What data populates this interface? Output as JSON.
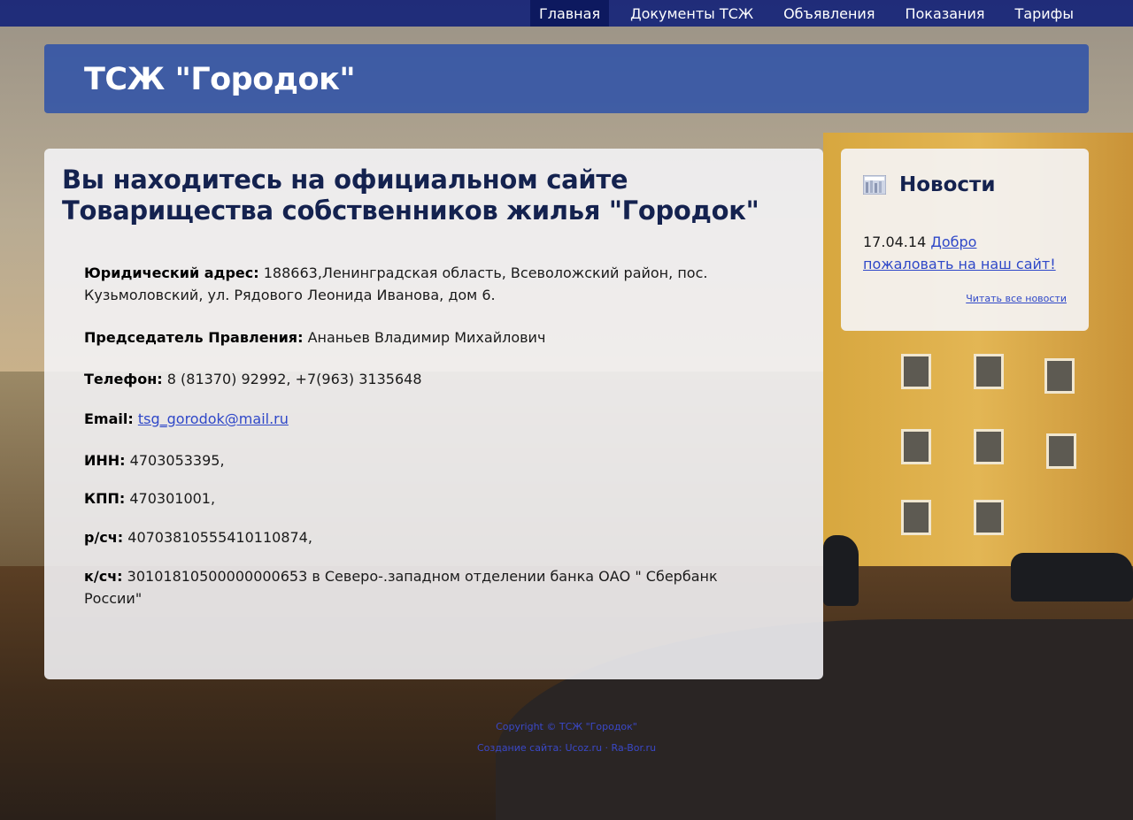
{
  "nav": {
    "items": [
      "Главная",
      "Документы ТСЖ",
      "Объявления",
      "Показания",
      "Тарифы"
    ],
    "active": "Главная"
  },
  "header": {
    "site_title": "ТСЖ \"Городок\""
  },
  "main": {
    "heading": "Вы находитесь на официальном сайте Товарищества собственников жилья \"Городок\"",
    "fields": {
      "address_label": "Юридический адрес:",
      "address_value": "188663,Ленинградская область, Всеволожский район, пос. Кузьмоловский, ул. Рядового Леонида Иванова, дом 6.",
      "chairman_label": "Председатель Правления:",
      "chairman_value": "Ананьев Владимир Михайлович",
      "phone_label": "Телефон:",
      "phone_value": "8 (81370) 92992, +7(963) 3135648",
      "email_label": "Email:",
      "email_value": "tsg_gorodok@mail.ru",
      "inn_label": "ИНН:",
      "inn_value": "4703053395,",
      "kpp_label": "КПП:",
      "kpp_value": "470301001,",
      "rs_label": "р/сч:",
      "rs_value": "40703810555410110874,",
      "ks_label": "к/сч:",
      "ks_value": "30101810500000000653 в Северо-.западном отделении банка ОАО \" Сбербанк России\""
    }
  },
  "news": {
    "title": "Новости",
    "item_date": "17.04.14",
    "item_link": "Добро пожаловать на наш сайт!",
    "all_link": "Читать все новости"
  },
  "footer": {
    "copyright": "Copyright © ТСЖ \"Городок\"",
    "credits": "Создание сайта: Ucoz.ru  · Ra-Bor.ru"
  },
  "colors": {
    "nav_bg": "#162478",
    "header_bg": "#284eaa",
    "heading_text": "#14224f",
    "link": "#2f48c8"
  }
}
